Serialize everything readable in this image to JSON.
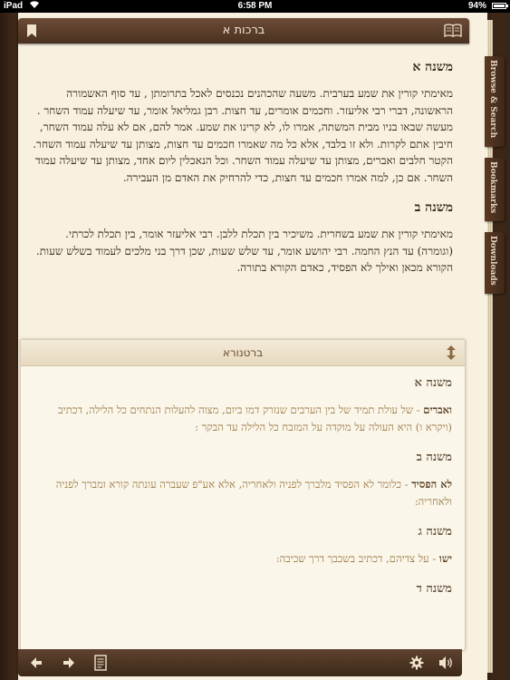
{
  "status_bar": {
    "device": "iPad",
    "time": "6:58 PM",
    "battery": "94%"
  },
  "top_bar": {
    "title": "ברכות א"
  },
  "side_tabs": {
    "browse": "Browse & Search",
    "bookmarks": "Bookmarks",
    "downloads": "Downloads"
  },
  "main": {
    "sections": [
      {
        "heading": "משנה א",
        "text": "מאימתי קורין את שמע בערבית. משעה שהכהנים נכנסים לאכל בתרומתן , עד סוף האשמורה הראשונה, דברי רבי אליעזר. וחכמים אומרים, עד חצות. רבן גמליאל אומר, עד שיעלה עמוד השחר . מעשה שבאו בניו מבית המשתה, אמרו לו, לא קרינו את שמע. אמר להם, אם לא עלה עמוד השחר, חיבין אתם לקרות. ולא זו בלבד, אלא כל מה שאמרו חכמים עד חצות, מצותן עד שיעלה עמוד השחר. הקטר חלבים ואברים, מצותן עד שיעלה עמוד השחר. וכל הנאכלין ליום אחד, מצותן עד שיעלה עמוד השחר. אם כן, למה אמרו חכמים עד חצות, כדי להרחיק את האדם מן העבירה."
      },
      {
        "heading": "משנה ב",
        "text": "מאימתי קורין את שמע בשחרית. משיכיר בין תכלת ללבן. רבי אליעזר אומר, בין תכלת לכרתי. (וגומרה) עד הנץ החמה. רבי יהושע אומר, עד שלש שעות, שכן דרך בני מלכים לעמוד בשלש שעות. הקורא מכאן ואילך לא הפסיד, כאדם הקורא בתורה."
      }
    ]
  },
  "commentary": {
    "title": "ברטנורא",
    "sections": [
      {
        "heading": "משנה א",
        "term": "ואברים",
        "text": " - של עולת תמיד של בין הערבים שנזרק דמו ביום, מצוה להעלות הנתחים כל הלילה, דכתיב (ויקרא ו) היא העולה על מוקדה על המזבח כל הלילה עד הבקר :"
      },
      {
        "heading": "משנה ב",
        "term": "לא הפסיד",
        "text": " - כלומר לא הפסיד מלברך לפניה ולאחריה, אלא אע\"פ שעברה עונתה קורא ומברך לפניה ולאחריה:"
      },
      {
        "heading": "משנה ג",
        "term": "ישו",
        "text": " - על צדיהם, דכתיב בשכבך דרך שכיבה:"
      },
      {
        "heading": "משנה ד",
        "term": "",
        "text": ""
      }
    ]
  },
  "toolbar": {
    "icons": [
      "back-arrow-icon",
      "forward-arrow-icon",
      "document-icon",
      "gear-icon",
      "speaker-icon"
    ]
  }
}
